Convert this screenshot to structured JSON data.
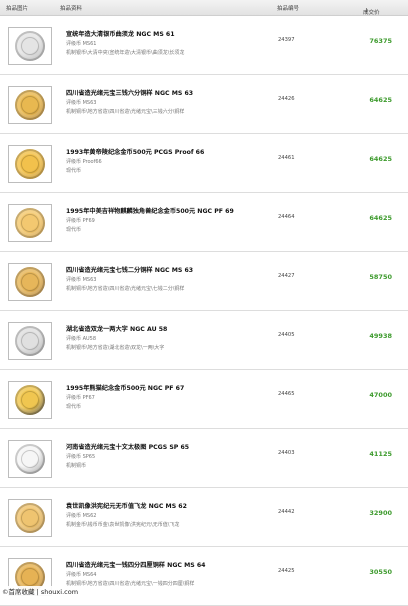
{
  "header": {
    "image_col": "拍品图片",
    "info_col": "拍品资料",
    "number_col": "拍品编号",
    "price_col": "成交价"
  },
  "lots": [
    {
      "title": "宣统年造大清银币曲须龙 NGC MS 61",
      "grade": "评级币 MS61",
      "category": "机制银币\\大清中央\\宣统年造\\大清银币\\曲须龙\\长须龙",
      "number": "24397",
      "price": "76375",
      "coin_colors": [
        "#e4e4e4",
        "#9a9a9a"
      ]
    },
    {
      "title": "四川省造光绪元宝三钱六分铜样 NGC MS 63",
      "grade": "评级币 MS63",
      "category": "机制铜币\\地方省造\\四川省造\\光绪元宝\\三钱六分\\铜样",
      "number": "24426",
      "price": "64625",
      "coin_colors": [
        "#e8b850",
        "#a06c18"
      ]
    },
    {
      "title": "1993年黄帝陵纪念金币500元 PCGS Proof 66",
      "grade": "评级币 Proof66",
      "category": "现代币",
      "number": "24461",
      "price": "64625",
      "coin_colors": [
        "#f2c14c",
        "#b07a10"
      ]
    },
    {
      "title": "1995年中美吉祥物麒麟独角兽纪念金币500元 NGC PF 69",
      "grade": "评级币 PF69",
      "category": "现代币",
      "number": "24464",
      "price": "64625",
      "coin_colors": [
        "#f3c870",
        "#c08a2a"
      ]
    },
    {
      "title": "四川省造光绪元宝七钱二分铜样 NGC MS 63",
      "grade": "评级币 MS63",
      "category": "机制铜币\\地方省造\\四川省造\\光绪元宝\\七钱二分\\铜样",
      "number": "24427",
      "price": "58750",
      "coin_colors": [
        "#e6b65a",
        "#9c6a20"
      ]
    },
    {
      "title": "湖北省造双龙一两大字 NGC AU 58",
      "grade": "评级币 AU58",
      "category": "机制银币\\地方省造\\湖北省造\\双龙\\一两\\大字",
      "number": "24405",
      "price": "49938",
      "coin_colors": [
        "#e0e0e0",
        "#8a8a8a"
      ]
    },
    {
      "title": "1995年熊猫纪念金币500元 NGC PF 67",
      "grade": "评级币 PF67",
      "category": "现代币",
      "number": "24465",
      "price": "47000",
      "coin_colors": [
        "#f0c650",
        "#1a1a1a"
      ]
    },
    {
      "title": "河南省造光绪元宝十文太极图 PCGS SP 65",
      "grade": "评级币 SP65",
      "category": "机制铜币",
      "number": "24403",
      "price": "41125",
      "coin_colors": [
        "#f6f6f6",
        "#6e6e6e"
      ]
    },
    {
      "title": "袁世凯像洪宪纪元无币值飞龙 NGC MS 62",
      "grade": "评级币 MS62",
      "category": "机制金币\\钱币币金\\袁世凯像\\洪宪纪元\\无币值\\飞龙",
      "number": "24442",
      "price": "32900",
      "coin_colors": [
        "#efc470",
        "#b08030"
      ]
    },
    {
      "title": "四川省造光绪元宝一钱四分四厘铜样 NGC MS 64",
      "grade": "评级币 MS64",
      "category": "机制铜币\\地方省造\\四川省造\\光绪元宝\\一钱四分四厘\\铜样",
      "number": "24425",
      "price": "30550",
      "coin_colors": [
        "#e6b254",
        "#9c6a1e"
      ]
    }
  ],
  "watermark": "©首席收藏 | shouxi.com"
}
